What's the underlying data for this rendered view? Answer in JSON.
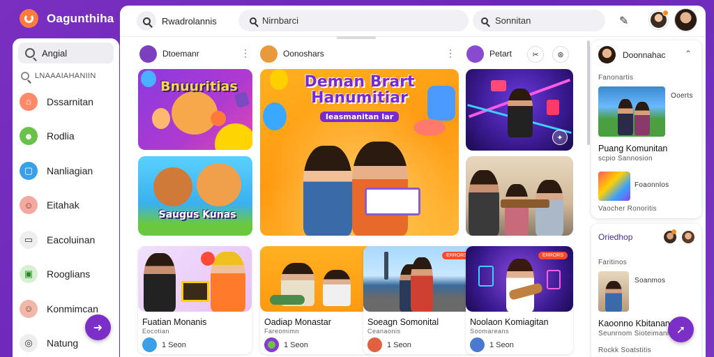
{
  "app": {
    "name": "Oagunthiha"
  },
  "sidebar": {
    "top_item": "Angial",
    "section_label": "LNAAAIAHANIIN",
    "items": [
      {
        "label": "Dssarnitan",
        "color": "#ff8a6a"
      },
      {
        "label": "Rodlia",
        "color": "#6ac24a"
      },
      {
        "label": "Nanliagian",
        "color": "#3aa0e8"
      },
      {
        "label": "Eitahak",
        "color": "#f4a8a0"
      },
      {
        "label": "Eacoluinan",
        "color": "#dddddd"
      },
      {
        "label": "Rooglians",
        "color": "#bfe8b8"
      },
      {
        "label": "Konmimcan",
        "color": "#f0b8a8"
      },
      {
        "label": "Natung",
        "color": "#dddddd"
      }
    ]
  },
  "topbar": {
    "left_search_label": "Rwadrolannis",
    "search_value": "Nirnbarci",
    "search_right_value": "Sonnitan"
  },
  "columns": [
    {
      "name": "Dtoemanr",
      "avatar_color": "#7b3fc0"
    },
    {
      "name": "Oonoshars",
      "avatar_color": "#e89a3a"
    },
    {
      "name": "Petart",
      "avatar_color": "#8a4ad0"
    }
  ],
  "featured": {
    "big_title_line1": "Deman Brart",
    "big_title_line2": "Hanumitiar",
    "big_title_line3": "Ieasmanitan Iar",
    "thumb1_title": "Bnuuritias",
    "thumb2_title": "Saugus Kunas"
  },
  "cards": [
    {
      "title": "Fuatian Monanis",
      "sub": "Eocotian",
      "meta": "1 Seon",
      "avatar": "#3aa0e8"
    },
    {
      "title": "Oadiap Monastar",
      "sub": "Fareomimn",
      "meta": "1 Seon",
      "avatar": "#6ac24a"
    },
    {
      "title": "Soeagn Somonital",
      "sub": "Ceanaonis",
      "meta": "1 Seon",
      "avatar": "#e06040"
    },
    {
      "title": "Noolaon Komiagitan",
      "sub": "Soomareans",
      "meta": "1 Seon",
      "avatar": "#4a7ad0",
      "badge": "ERRORS"
    }
  ],
  "right_panel": {
    "card1": {
      "header": "Doonnahac",
      "label": "Fanonartis",
      "side_text": "Ooerts",
      "title": "Puang Komunitan",
      "sub": "scpio Sannosion",
      "row_text": "Foaonnlos",
      "footer": "Vaocher Ronoritis"
    },
    "card2": {
      "header": "Oriedhop",
      "label": "Faritinos",
      "side_text": "Soanmos",
      "title": "Kaoonno Kbitanan",
      "sub": "Seunrnom Sioteimanis",
      "footer": "Rockk Soatstitis"
    }
  }
}
